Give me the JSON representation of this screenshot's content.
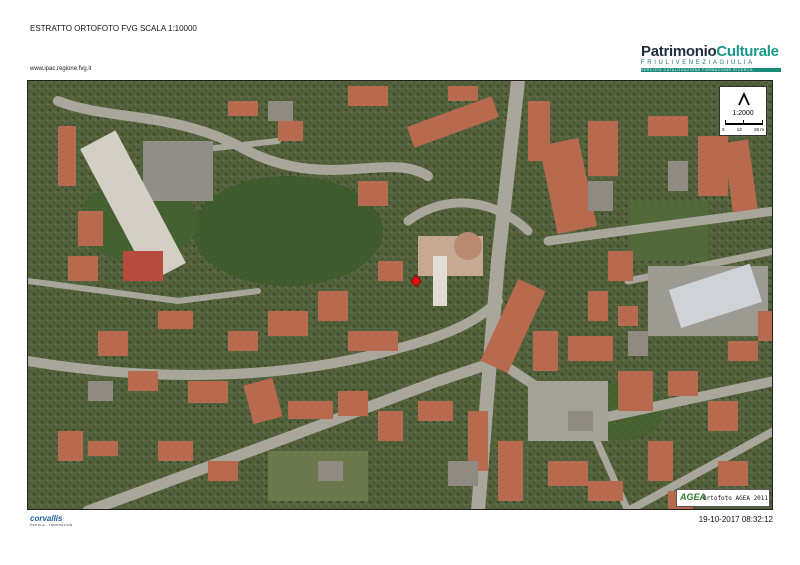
{
  "header": {
    "title": "ESTRATTO ORTOFOTO FVG SCALA 1:10000",
    "url": "www.ipac.regione.fvg.it"
  },
  "logo": {
    "part1": "Patrimonio",
    "part2": "Culturale",
    "subtitle": "FRIULIVENEZIAGIULIA",
    "tagline": "SERVIZIO CATALOGAZIONE FORMAZIONE RICERCA"
  },
  "map": {
    "scale_ratio": "1:2000",
    "scale_labels": [
      "0",
      "13",
      "26 m"
    ],
    "north_icon": "north-arrow-icon",
    "marker_icon": "location-marker-icon",
    "colors": {
      "vegetation": "#4a5a33",
      "roofs": "#b86a4e",
      "roads": "#a9a79b",
      "marker": "#e01010"
    }
  },
  "agea": {
    "logo_text": "AGEA",
    "label": "Ortofoto AGEA 2011"
  },
  "footer": {
    "brand": "corvallis",
    "brand_tag": "PEOPLE · INNOVATION",
    "timestamp": "19-10-2017 08:32:12"
  }
}
